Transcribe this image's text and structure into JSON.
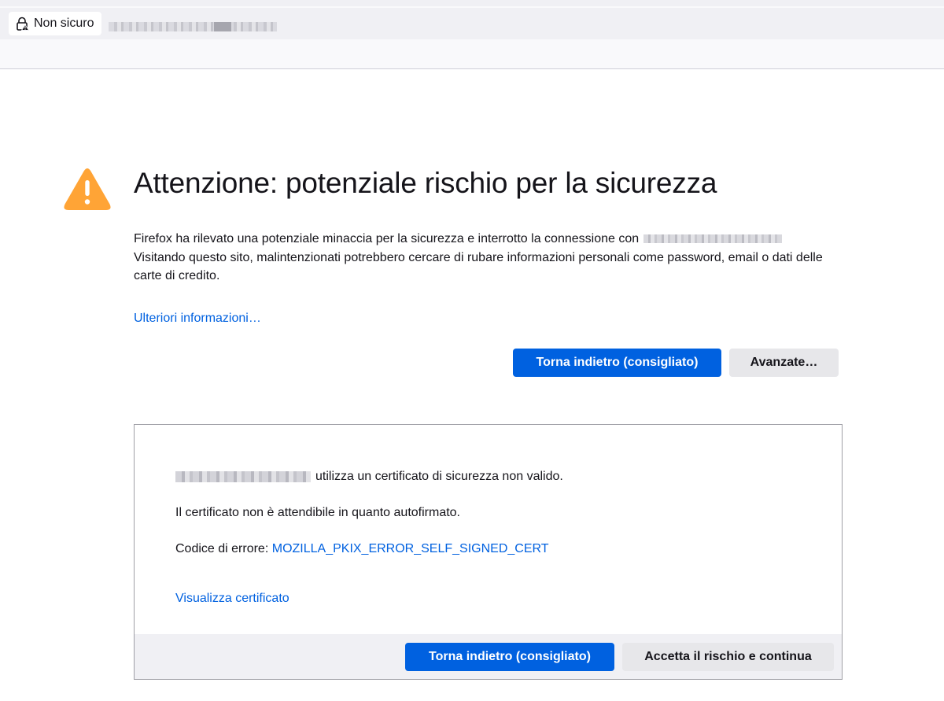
{
  "browser": {
    "identity_label": "Non sicuro"
  },
  "page": {
    "title": "Attenzione: potenziale rischio per la sicurezza",
    "intro_line1": "Firefox ha rilevato una potenziale minaccia per la sicurezza e interrotto la connessione con",
    "intro_line2": "Visitando questo sito, malintenzionati potrebbero cercare di rubare informazioni personali come password, email o dati delle carte di credito.",
    "more_info_link": "Ulteriori informazioni…",
    "back_button": "Torna indietro (consigliato)",
    "advanced_button": "Avanzate…"
  },
  "advanced_panel": {
    "invalid_cert_text": "utilizza un certificato di sicurezza non valido.",
    "self_signed_text": "Il certificato non è attendibile in quanto autofirmato.",
    "error_code_label": "Codice di errore:",
    "error_code": "MOZILLA_PKIX_ERROR_SELF_SIGNED_CERT",
    "view_certificate_link": "Visualizza certificato",
    "back_button": "Torna indietro (consigliato)",
    "accept_button": "Accetta il rischio e continua"
  },
  "colors": {
    "accent": "#0061e0",
    "warning": "#ffa436"
  },
  "icons": {
    "identity": "lock-warning-icon",
    "warning": "warning-triangle-icon"
  }
}
